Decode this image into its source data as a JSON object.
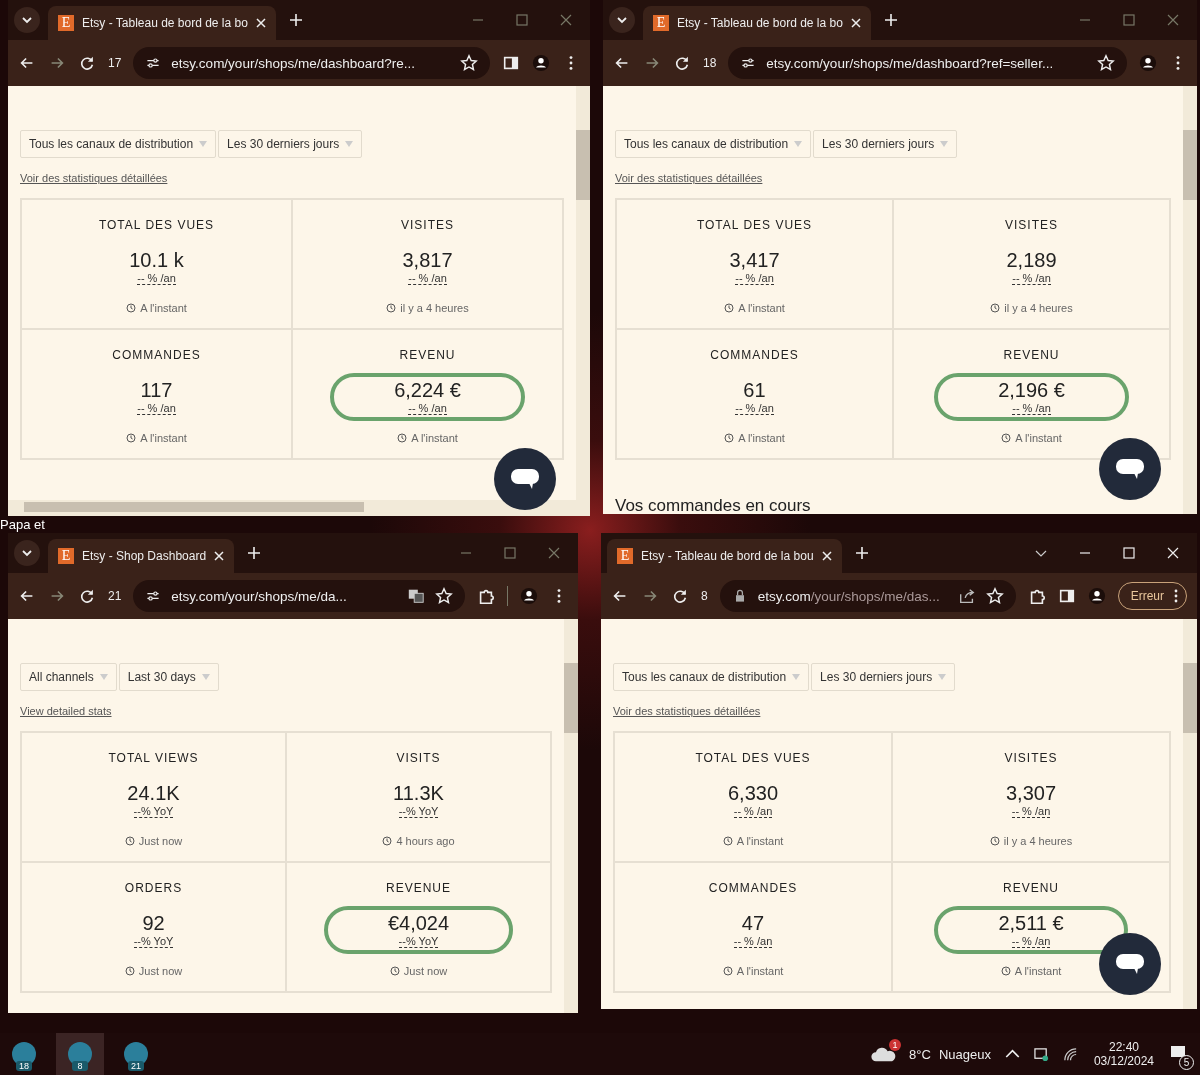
{
  "desktop": {
    "label": "Papa et"
  },
  "windows": [
    {
      "favicon_letter": "E",
      "tab_title": "Etsy - Tableau de bord de la bo",
      "tab_search_left": true,
      "tab_count": "17",
      "secure_lock": false,
      "url_host": "etsy.com/your/shops/me/dashboard?re...",
      "toolbar_icons": [
        {
          "kind": "star"
        },
        {
          "kind": "side-panel"
        },
        {
          "kind": "profile"
        },
        {
          "kind": "menu"
        }
      ],
      "channel_filter": "Tous les canaux de distribution",
      "period_filter": "Les 30 derniers jours",
      "stats_link": "Voir des statistiques détaillées",
      "stats": [
        {
          "label": "TOTAL DES VUES",
          "value": "10.1 k",
          "change": "-- % /an",
          "time": "A l'instant",
          "highlighted": false
        },
        {
          "label": "VISITES",
          "value": "3,817",
          "change": "-- % /an",
          "time": "il y a 4 heures",
          "highlighted": false
        },
        {
          "label": "COMMANDES",
          "value": "117",
          "change": "-- % /an",
          "time": "A l'instant",
          "highlighted": false
        },
        {
          "label": "REVENU",
          "value": "6,224 €",
          "change": "-- % /an",
          "time": "A l'instant",
          "highlighted": true
        }
      ],
      "chat_button": true,
      "horizontal_scrollbar": true
    },
    {
      "favicon_letter": "E",
      "tab_title": "Etsy - Tableau de bord de la bo",
      "tab_search_left": true,
      "tab_count": "18",
      "secure_lock": false,
      "url_host": "etsy.com/your/shops/me/dashboard?ref=seller...",
      "toolbar_icons": [
        {
          "kind": "star"
        },
        {
          "kind": "profile"
        },
        {
          "kind": "menu"
        }
      ],
      "channel_filter": "Tous les canaux de distribution",
      "period_filter": "Les 30 derniers jours",
      "stats_link": "Voir des statistiques détaillées",
      "stats": [
        {
          "label": "TOTAL DES VUES",
          "value": "3,417",
          "change": "-- % /an",
          "time": "A l'instant",
          "highlighted": false
        },
        {
          "label": "VISITES",
          "value": "2,189",
          "change": "-- % /an",
          "time": "il y a 4 heures",
          "highlighted": false
        },
        {
          "label": "COMMANDES",
          "value": "61",
          "change": "-- % /an",
          "time": "A l'instant",
          "highlighted": false
        },
        {
          "label": "REVENU",
          "value": "2,196 €",
          "change": "-- % /an",
          "time": "A l'instant",
          "highlighted": true
        }
      ],
      "section_heading": "Vos commandes en cours",
      "chat_button": true
    },
    {
      "favicon_letter": "E",
      "tab_title": "Etsy - Shop Dashboard",
      "tab_search_left": true,
      "tab_count": "21",
      "secure_lock": false,
      "url_host": "etsy.com/your/shops/me/da...",
      "toolbar_icons": [
        {
          "kind": "translate"
        },
        {
          "kind": "star"
        },
        {
          "kind": "extension"
        },
        {
          "kind": "divider"
        },
        {
          "kind": "profile"
        },
        {
          "kind": "menu"
        }
      ],
      "channel_filter": "All channels",
      "period_filter": "Last 30 days",
      "stats_link": "View detailed stats",
      "stats": [
        {
          "label": "TOTAL VIEWS",
          "value": "24.1K",
          "change": "--% YoY",
          "time": "Just now",
          "highlighted": false
        },
        {
          "label": "VISITS",
          "value": "11.3K",
          "change": "--% YoY",
          "time": "4 hours ago",
          "highlighted": false
        },
        {
          "label": "ORDERS",
          "value": "92",
          "change": "--% YoY",
          "time": "Just now",
          "highlighted": false
        },
        {
          "label": "REVENUE",
          "value": "€4,024",
          "change": "--% YoY",
          "time": "Just now",
          "highlighted": true
        }
      ]
    },
    {
      "favicon_letter": "E",
      "tab_title": "Etsy - Tableau de bord de la bou",
      "tab_search_left": false,
      "tab_count": "8",
      "secure_lock": true,
      "url_host": "etsy.com",
      "url_path": "/your/shops/me/das...",
      "toolbar_icons": [
        {
          "kind": "share"
        },
        {
          "kind": "star"
        },
        {
          "kind": "extension"
        },
        {
          "kind": "side-panel"
        },
        {
          "kind": "profile"
        }
      ],
      "error_button": "Erreur",
      "channel_filter": "Tous les canaux de distribution",
      "period_filter": "Les 30 derniers jours",
      "stats_link": "Voir des statistiques détaillées",
      "stats": [
        {
          "label": "TOTAL DES VUES",
          "value": "6,330",
          "change": "-- % /an",
          "time": "A l'instant",
          "highlighted": false
        },
        {
          "label": "VISITES",
          "value": "3,307",
          "change": "-- % /an",
          "time": "il y a 4 heures",
          "highlighted": false
        },
        {
          "label": "COMMANDES",
          "value": "47",
          "change": "-- % /an",
          "time": "A l'instant",
          "highlighted": false
        },
        {
          "label": "REVENU",
          "value": "2,511 €",
          "change": "-- % /an",
          "time": "A l'instant",
          "highlighted": true
        }
      ],
      "chat_button": true
    }
  ],
  "taskbar": {
    "apps": [
      {
        "badge": "18",
        "selected": false
      },
      {
        "badge": "8",
        "selected": true
      },
      {
        "badge": "21",
        "selected": false
      }
    ],
    "weather": {
      "alert": "1",
      "temperature": "8°C",
      "condition": "Nuageux"
    },
    "time": "22:40",
    "date": "03/12/2024",
    "notifications": "5"
  }
}
